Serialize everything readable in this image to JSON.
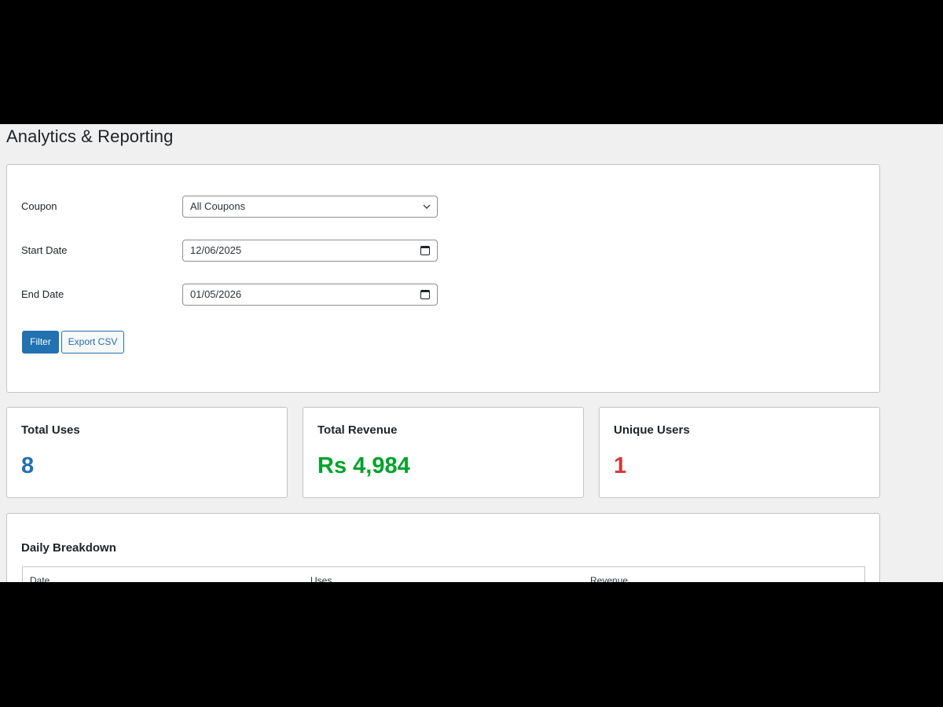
{
  "page": {
    "title": "Analytics & Reporting"
  },
  "filters": {
    "coupon_label": "Coupon",
    "coupon_value": "All Coupons",
    "start_label": "Start Date",
    "start_value": "12/06/2025",
    "end_label": "End Date",
    "end_value": "01/05/2026",
    "filter_button": "Filter",
    "export_button": "Export CSV"
  },
  "stats": [
    {
      "title": "Total Uses",
      "value": "8",
      "color": "#2271b1"
    },
    {
      "title": "Total Revenue",
      "value": "Rs 4,984",
      "color": "#00a32a"
    },
    {
      "title": "Unique Users",
      "value": "1",
      "color": "#d63638"
    }
  ],
  "breakdown": {
    "title": "Daily Breakdown",
    "columns": [
      "Date",
      "Uses",
      "Revenue"
    ]
  },
  "icons": {
    "select": "chevron-down-icon",
    "date": "calendar-icon"
  }
}
